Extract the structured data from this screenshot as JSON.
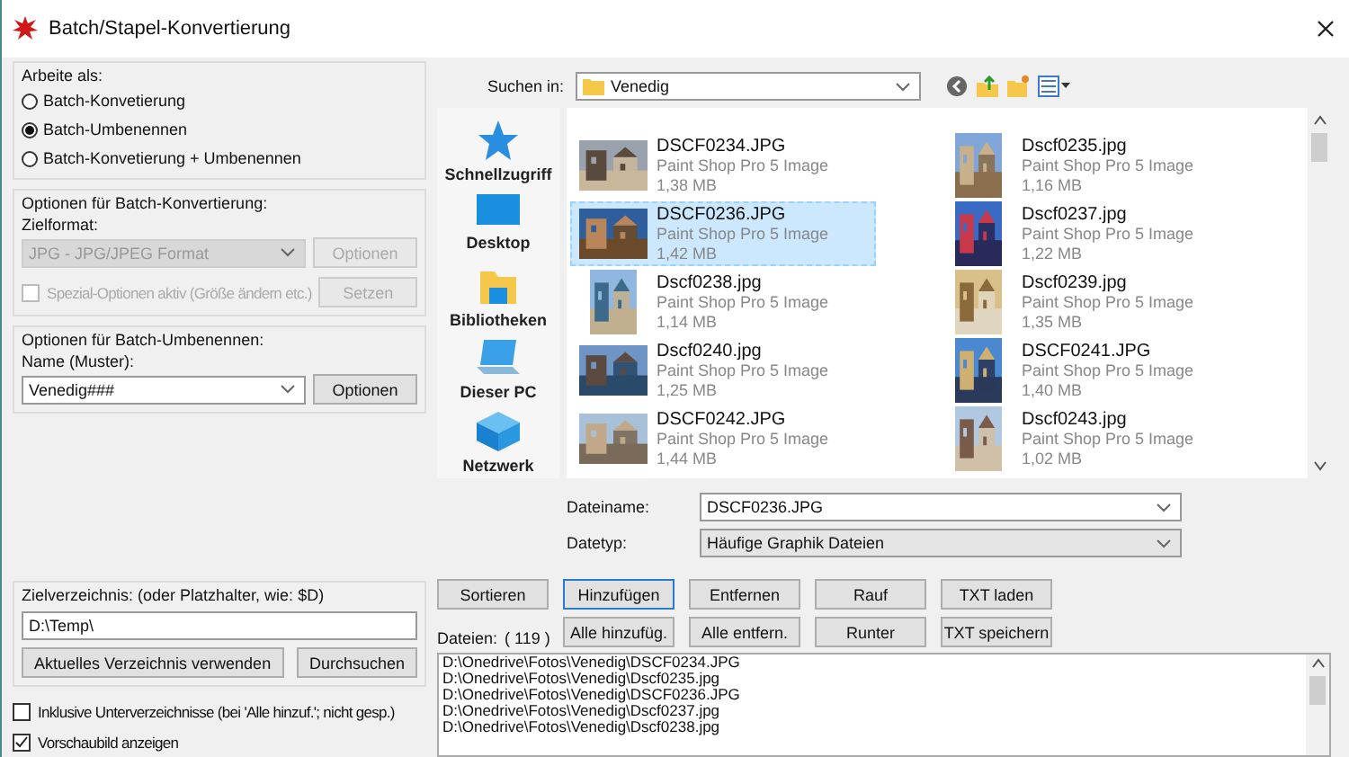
{
  "window": {
    "title": "Batch/Stapel-Konvertierung"
  },
  "work_as": {
    "label": "Arbeite als:",
    "options": [
      {
        "label": "Batch-Konvetierung",
        "selected": false
      },
      {
        "label": "Batch-Umbenennen",
        "selected": true
      },
      {
        "label": "Batch-Konvetierung + Umbenennen",
        "selected": false
      }
    ]
  },
  "conversion": {
    "label": "Optionen für Batch-Konvertierung:",
    "format_label": "Zielformat:",
    "format_value": "JPG - JPG/JPEG Format",
    "format_disabled": true,
    "options_button": "Optionen",
    "special": {
      "label": "Spezial-Optionen aktiv (Größe ändern etc.)",
      "checked": false,
      "disabled": true
    },
    "set_button": "Setzen"
  },
  "rename": {
    "label": "Optionen für Batch-Umbenennen:",
    "name_label": "Name (Muster):",
    "name_value": "Venedig###",
    "options_button": "Optionen"
  },
  "target": {
    "label": "Zielverzeichnis: (oder Platzhalter, wie: $D)",
    "value": "D:\\Temp\\",
    "current_button": "Aktuelles Verzeichnis verwenden",
    "browse_button": "Durchsuchen"
  },
  "checkboxes": [
    {
      "label": "Inklusive Unterverzeichnisse (bei 'Alle hinzuf.'; nicht gesp.)",
      "checked": false
    },
    {
      "label": "Vorschaubild anzeigen",
      "checked": true
    }
  ],
  "look_in": {
    "label": "Suchen in:",
    "value": "Venedig"
  },
  "places": [
    {
      "label": "Schnellzugriff",
      "kind": "star"
    },
    {
      "label": "Desktop",
      "kind": "desktop"
    },
    {
      "label": "Bibliotheken",
      "kind": "library"
    },
    {
      "label": "Dieser PC",
      "kind": "pc"
    },
    {
      "label": "Netzwerk",
      "kind": "network"
    }
  ],
  "files": [
    {
      "name": "DSCF0234.JPG",
      "type": "Paint Shop Pro 5 Image",
      "size": "1,38 MB",
      "selected": false
    },
    {
      "name": "Dscf0235.jpg",
      "type": "Paint Shop Pro 5 Image",
      "size": "1,16 MB",
      "selected": false
    },
    {
      "name": "DSCF0236.JPG",
      "type": "Paint Shop Pro 5 Image",
      "size": "1,42 MB",
      "selected": true
    },
    {
      "name": "Dscf0237.jpg",
      "type": "Paint Shop Pro 5 Image",
      "size": "1,22 MB",
      "selected": false
    },
    {
      "name": "Dscf0238.jpg",
      "type": "Paint Shop Pro 5 Image",
      "size": "1,14 MB",
      "selected": false
    },
    {
      "name": "Dscf0239.jpg",
      "type": "Paint Shop Pro 5 Image",
      "size": "1,35 MB",
      "selected": false
    },
    {
      "name": "Dscf0240.jpg",
      "type": "Paint Shop Pro 5 Image",
      "size": "1,25 MB",
      "selected": false
    },
    {
      "name": "DSCF0241.JPG",
      "type": "Paint Shop Pro 5 Image",
      "size": "1,40 MB",
      "selected": false
    },
    {
      "name": "DSCF0242.JPG",
      "type": "Paint Shop Pro 5 Image",
      "size": "1,44 MB",
      "selected": false
    },
    {
      "name": "Dscf0243.jpg",
      "type": "Paint Shop Pro 5 Image",
      "size": "1,02 MB",
      "selected": false
    }
  ],
  "filename": {
    "label": "Dateiname:",
    "value": "DSCF0236.JPG"
  },
  "filetype": {
    "label": "Datetyp:",
    "value": "Häufige Graphik Dateien"
  },
  "buttons_row1": [
    "Sortieren",
    "Hinzufügen",
    "Entfernen",
    "Rauf",
    "TXT laden"
  ],
  "buttons_row2": [
    "Alle hinzufüg.",
    "Alle entfern.",
    "Runter",
    "TXT speichern"
  ],
  "files_label": "Dateien:",
  "files_count": "( 119 )",
  "file_list": [
    "D:\\Onedrive\\Fotos\\Venedig\\DSCF0234.JPG",
    "D:\\Onedrive\\Fotos\\Venedig\\Dscf0235.jpg",
    "D:\\Onedrive\\Fotos\\Venedig\\DSCF0236.JPG",
    "D:\\Onedrive\\Fotos\\Venedig\\Dscf0237.jpg",
    "D:\\Onedrive\\Fotos\\Venedig\\Dscf0238.jpg"
  ]
}
